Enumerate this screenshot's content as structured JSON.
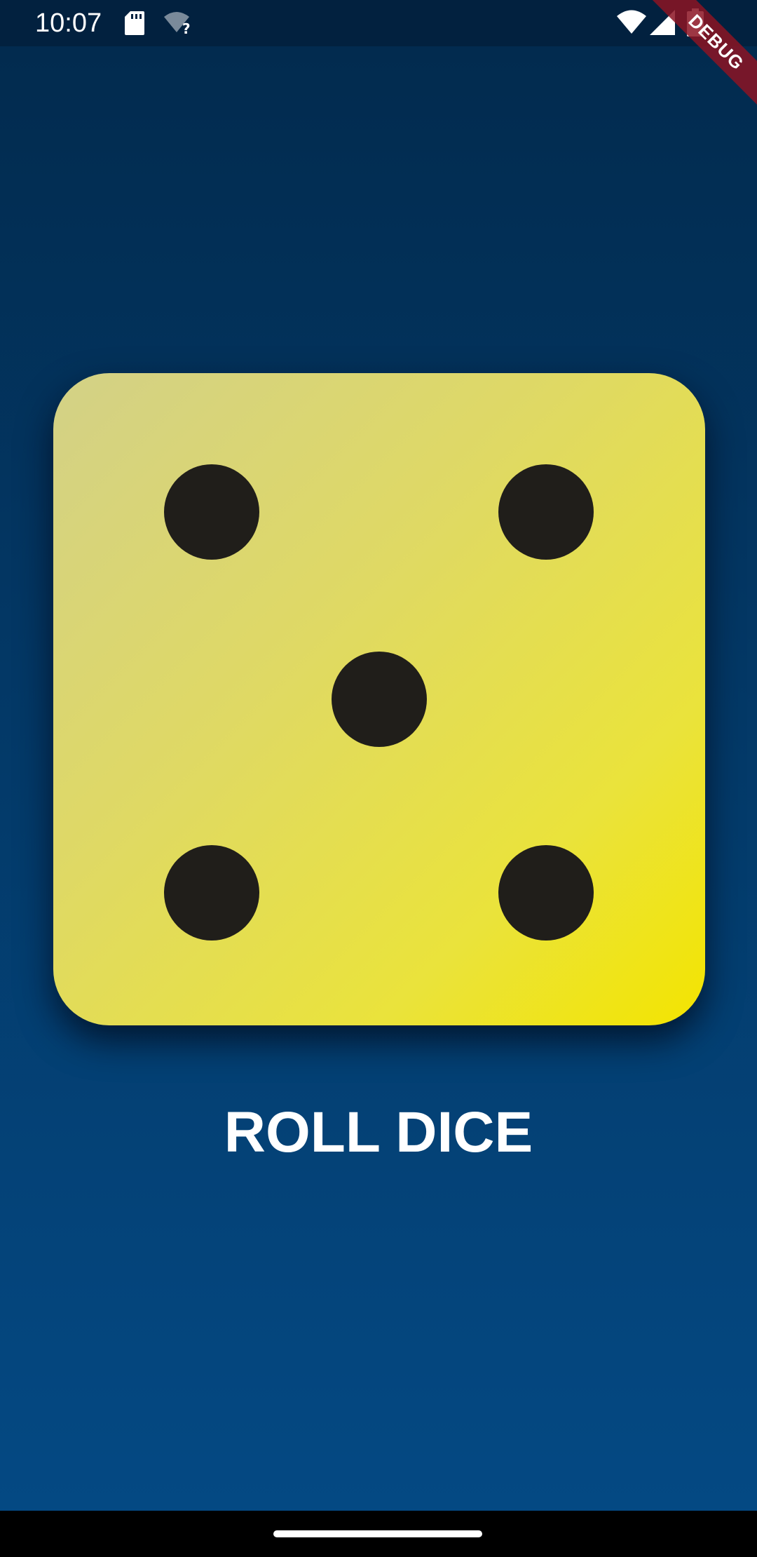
{
  "status_bar": {
    "time": "10:07",
    "icons": [
      "sd-card-icon",
      "wifi-unknown-icon",
      "wifi-icon",
      "signal-icon",
      "battery-icon"
    ]
  },
  "debug_banner": {
    "label": "DEBUG"
  },
  "dice": {
    "face_value": 5,
    "pips": 5
  },
  "roll_button": {
    "label": "ROLL DICE"
  },
  "colors": {
    "background_top": "#022a4d",
    "background_bottom": "#044a85",
    "dice_yellow": "#f3e400",
    "dice_light": "#d3d187",
    "pip": "#201e1a",
    "debug_ribbon": "#8c1423",
    "button_text": "#ffffff"
  }
}
